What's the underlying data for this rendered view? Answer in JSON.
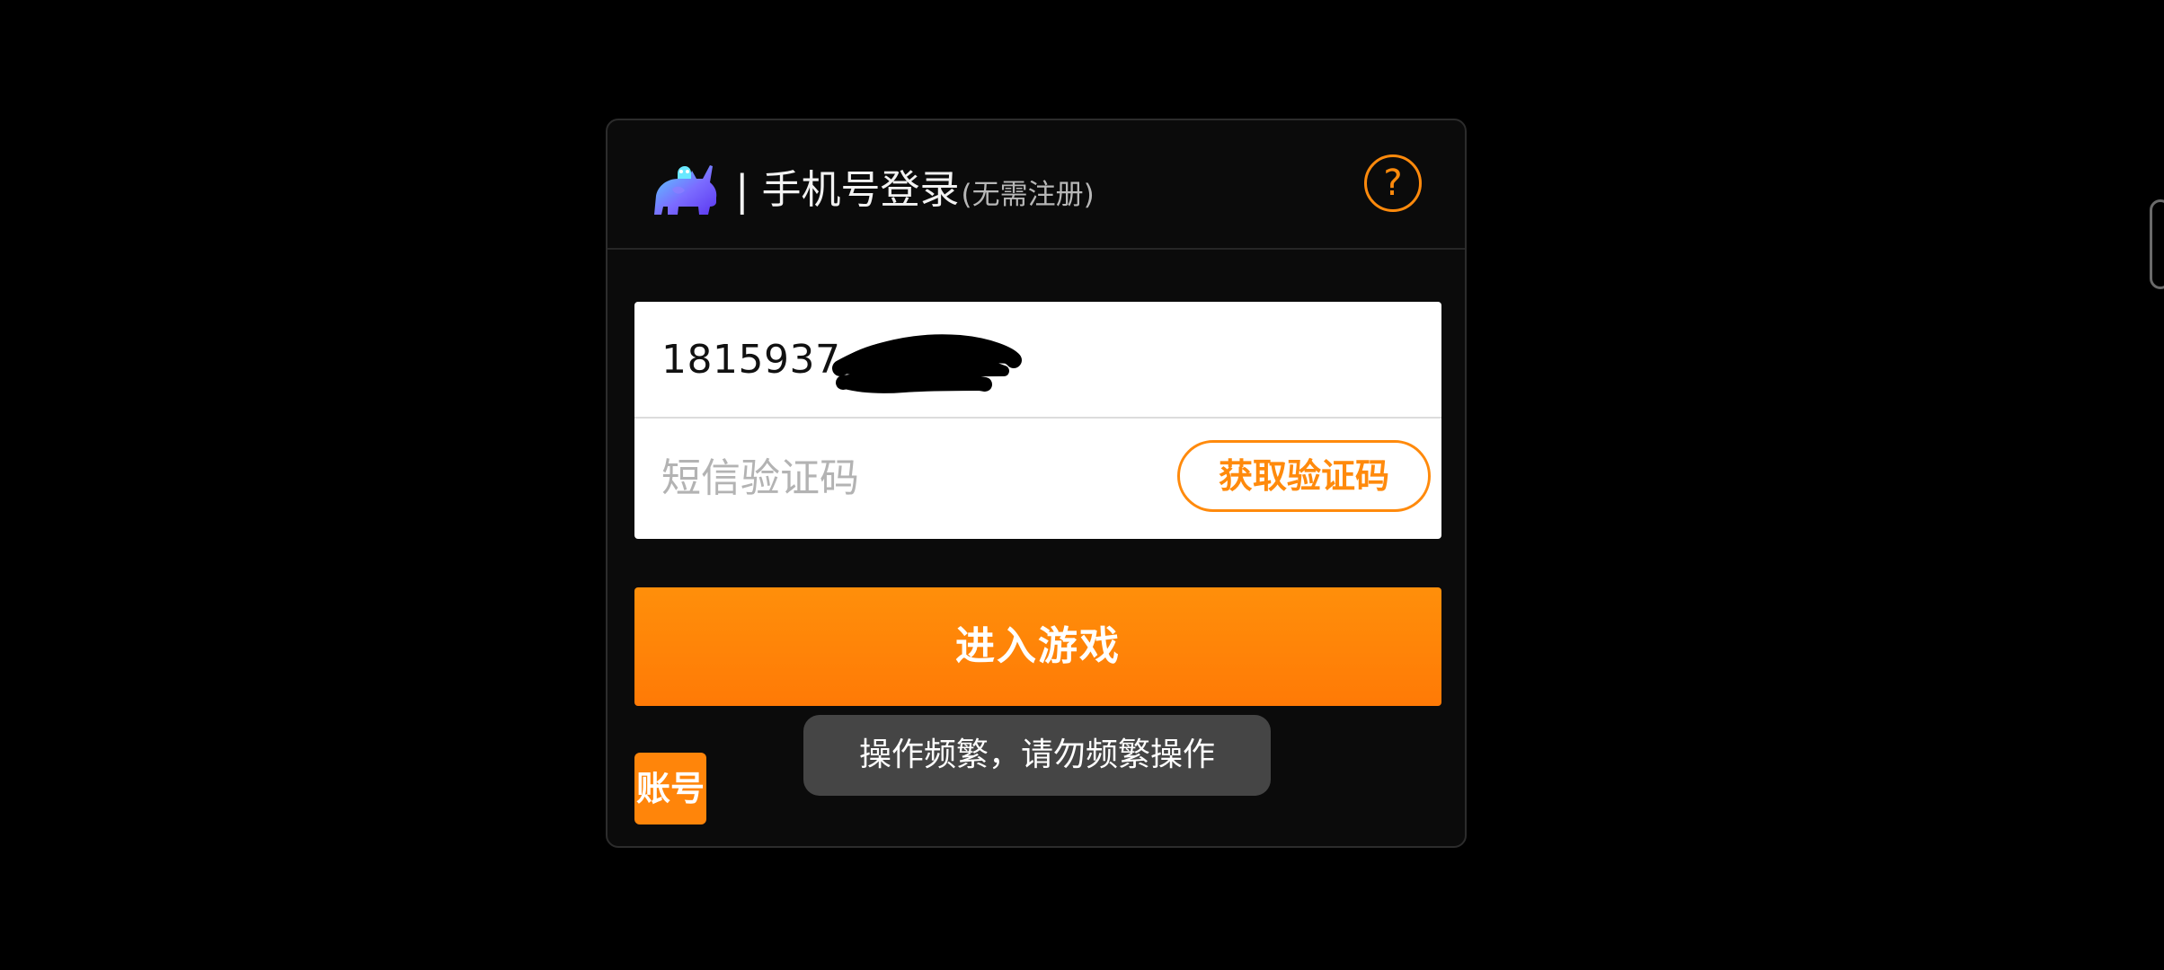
{
  "header": {
    "separator": "|",
    "title": "手机号登录",
    "subtitle": "(无需注册)",
    "logo_icon": "rhino-logo-icon",
    "help_label": "?",
    "help_icon": "help-circle-icon"
  },
  "form": {
    "phone_value": "1815937",
    "phone_redaction": "black-scribble-redaction",
    "sms_code_placeholder": "短信验证码",
    "sms_code_value": "",
    "get_code_label": "获取验证码"
  },
  "actions": {
    "enter_game_label": "进入游戏",
    "account_label": "账号"
  },
  "toast": {
    "message": "操作频繁，请勿频繁操作"
  },
  "colors": {
    "accent": "#ff8a0c",
    "background": "#000000",
    "panel": "#0b0b0b",
    "card": "#ffffff",
    "toast": "#4b4b4b"
  }
}
